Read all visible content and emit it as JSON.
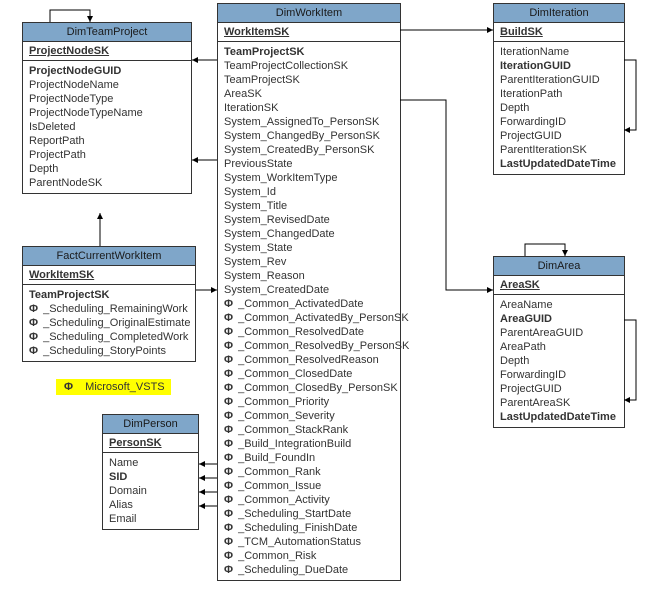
{
  "legend": "Microsoft_VSTS",
  "entities": {
    "dimTeamProject": {
      "title": "DimTeamProject",
      "key": "ProjectNodeSK",
      "fields": [
        {
          "t": "ProjectNodeGUID",
          "b": 1
        },
        {
          "t": "ProjectNodeName"
        },
        {
          "t": "ProjectNodeType"
        },
        {
          "t": "ProjectNodeTypeName"
        },
        {
          "t": "IsDeleted"
        },
        {
          "t": "ReportPath"
        },
        {
          "t": "ProjectPath"
        },
        {
          "t": "Depth"
        },
        {
          "t": "ParentNodeSK"
        }
      ]
    },
    "factCurrentWorkItem": {
      "title": "FactCurrentWorkItem",
      "key": "WorkItemSK",
      "fields": [
        {
          "t": "TeamProjectSK",
          "b": 1
        },
        {
          "t": "_Scheduling_RemainingWork",
          "p": 1
        },
        {
          "t": "_Scheduling_OriginalEstimate",
          "p": 1
        },
        {
          "t": "_Scheduling_CompletedWork",
          "p": 1
        },
        {
          "t": "_Scheduling_StoryPoints",
          "p": 1
        }
      ]
    },
    "dimPerson": {
      "title": "DimPerson",
      "key": "PersonSK",
      "fields": [
        {
          "t": "Name"
        },
        {
          "t": "SID",
          "b": 1
        },
        {
          "t": "Domain"
        },
        {
          "t": "Alias"
        },
        {
          "t": "Email"
        }
      ]
    },
    "dimWorkItem": {
      "title": "DimWorkItem",
      "key": "WorkItemSK",
      "fields": [
        {
          "t": "TeamProjectSK",
          "b": 1
        },
        {
          "t": "TeamProjectCollectionSK"
        },
        {
          "t": "TeamProjectSK"
        },
        {
          "t": "AreaSK"
        },
        {
          "t": "IterationSK"
        },
        {
          "t": "System_AssignedTo_PersonSK"
        },
        {
          "t": "System_ChangedBy_PersonSK"
        },
        {
          "t": "System_CreatedBy_PersonSK"
        },
        {
          "t": "PreviousState"
        },
        {
          "t": "System_WorkItemType"
        },
        {
          "t": "System_Id"
        },
        {
          "t": "System_Title"
        },
        {
          "t": "System_RevisedDate"
        },
        {
          "t": "System_ChangedDate"
        },
        {
          "t": "System_State"
        },
        {
          "t": "System_Rev"
        },
        {
          "t": "System_Reason"
        },
        {
          "t": "System_CreatedDate"
        },
        {
          "t": "_Common_ActivatedDate",
          "p": 1
        },
        {
          "t": "_Common_ActivatedBy_PersonSK",
          "p": 1
        },
        {
          "t": "_Common_ResolvedDate",
          "p": 1
        },
        {
          "t": "_Common_ResolvedBy_PersonSK",
          "p": 1
        },
        {
          "t": "_Common_ResolvedReason",
          "p": 1
        },
        {
          "t": "_Common_ClosedDate",
          "p": 1
        },
        {
          "t": "_Common_ClosedBy_PersonSK",
          "p": 1
        },
        {
          "t": "_Common_Priority",
          "p": 1
        },
        {
          "t": "_Common_Severity",
          "p": 1
        },
        {
          "t": "_Common_StackRank",
          "p": 1
        },
        {
          "t": "_Build_IntegrationBuild",
          "p": 1
        },
        {
          "t": "_Build_FoundIn",
          "p": 1
        },
        {
          "t": "_Common_Rank",
          "p": 1
        },
        {
          "t": "_Common_Issue",
          "p": 1
        },
        {
          "t": "_Common_Activity",
          "p": 1
        },
        {
          "t": "_Scheduling_StartDate",
          "p": 1
        },
        {
          "t": "_Scheduling_FinishDate",
          "p": 1
        },
        {
          "t": "_TCM_AutomationStatus",
          "p": 1
        },
        {
          "t": "_Common_Risk",
          "p": 1
        },
        {
          "t": "_Scheduling_DueDate",
          "p": 1
        }
      ]
    },
    "dimIteration": {
      "title": "DimIteration",
      "key": "BuildSK",
      "fields": [
        {
          "t": "IterationName"
        },
        {
          "t": "IterationGUID",
          "b": 1
        },
        {
          "t": "ParentIterationGUID"
        },
        {
          "t": "IterationPath"
        },
        {
          "t": "Depth"
        },
        {
          "t": "ForwardingID"
        },
        {
          "t": "ProjectGUID"
        },
        {
          "t": "ParentIterationSK"
        },
        {
          "t": "LastUpdatedDateTime",
          "b": 1
        }
      ]
    },
    "dimArea": {
      "title": "DimArea",
      "key": "AreaSK",
      "fields": [
        {
          "t": "AreaName"
        },
        {
          "t": "AreaGUID",
          "b": 1
        },
        {
          "t": "ParentAreaGUID"
        },
        {
          "t": "AreaPath"
        },
        {
          "t": "Depth"
        },
        {
          "t": "ForwardingID"
        },
        {
          "t": "ProjectGUID"
        },
        {
          "t": "ParentAreaSK"
        },
        {
          "t": "LastUpdatedDateTime",
          "b": 1
        }
      ]
    }
  }
}
